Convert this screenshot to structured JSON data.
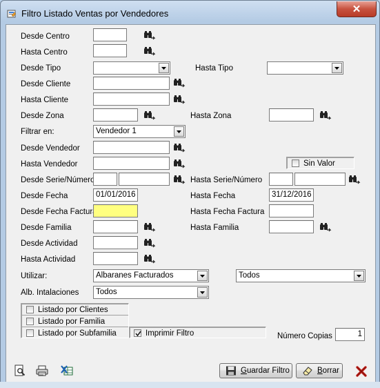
{
  "window": {
    "title": "Filtro Listado Ventas por Vendedores",
    "close_label": "✕"
  },
  "fields": {
    "desde_centro": {
      "label": "Desde Centro",
      "value": ""
    },
    "hasta_centro": {
      "label": "Hasta Centro",
      "value": ""
    },
    "desde_tipo": {
      "label": "Desde Tipo",
      "value": ""
    },
    "hasta_tipo": {
      "label": "Hasta Tipo",
      "value": ""
    },
    "desde_cliente": {
      "label": "Desde Cliente",
      "value": ""
    },
    "hasta_cliente": {
      "label": "Hasta Cliente",
      "value": ""
    },
    "desde_zona": {
      "label": "Desde Zona",
      "value": ""
    },
    "hasta_zona": {
      "label": "Hasta Zona",
      "value": ""
    },
    "filtrar_en": {
      "label": "Filtrar en:",
      "value": "Vendedor 1"
    },
    "desde_vendedor": {
      "label": "Desde Vendedor",
      "value": ""
    },
    "hasta_vendedor": {
      "label": "Hasta Vendedor",
      "value": ""
    },
    "sin_valor": {
      "label": "Sin Valor",
      "checked": false
    },
    "desde_serie": {
      "label": "Desde Serie/Número",
      "serie": "",
      "numero": ""
    },
    "hasta_serie": {
      "label": "Hasta Serie/Número",
      "serie": "",
      "numero": ""
    },
    "desde_fecha": {
      "label": "Desde Fecha",
      "value": "01/01/2016"
    },
    "hasta_fecha": {
      "label": "Hasta Fecha",
      "value": "31/12/2016"
    },
    "desde_fecha_factura": {
      "label": "Desde Fecha Factura",
      "value": ""
    },
    "hasta_fecha_factura": {
      "label": "Hasta Fecha Factura",
      "value": ""
    },
    "desde_familia": {
      "label": "Desde Familia",
      "value": ""
    },
    "hasta_familia": {
      "label": "Hasta Familia",
      "value": ""
    },
    "desde_actividad": {
      "label": "Desde Actividad",
      "value": ""
    },
    "hasta_actividad": {
      "label": "Hasta Actividad",
      "value": ""
    },
    "utilizar": {
      "label": "Utilizar:",
      "value": "Albaranes Facturados",
      "value2": "Todos"
    },
    "alb_instalaciones": {
      "label": "Alb. Intalaciones",
      "value": "Todos"
    }
  },
  "options": {
    "listado_clientes": {
      "label": "Listado por Clientes",
      "checked": false
    },
    "listado_familia": {
      "label": "Listado por Familia",
      "checked": false
    },
    "listado_subfamilia": {
      "label": "Listado por Subfamilia",
      "checked": false
    },
    "imprimir_filtro": {
      "label": "Imprimir Filtro",
      "checked": true
    }
  },
  "copias": {
    "label": "Número Copias",
    "value": "1"
  },
  "buttons": {
    "guardar_pre": "G",
    "guardar_rest": "uardar Filtro",
    "borrar_pre": "B",
    "borrar_rest": "orrar"
  },
  "colors": {
    "highlight_field": "#ffff80",
    "close_red": "#c7523f"
  }
}
